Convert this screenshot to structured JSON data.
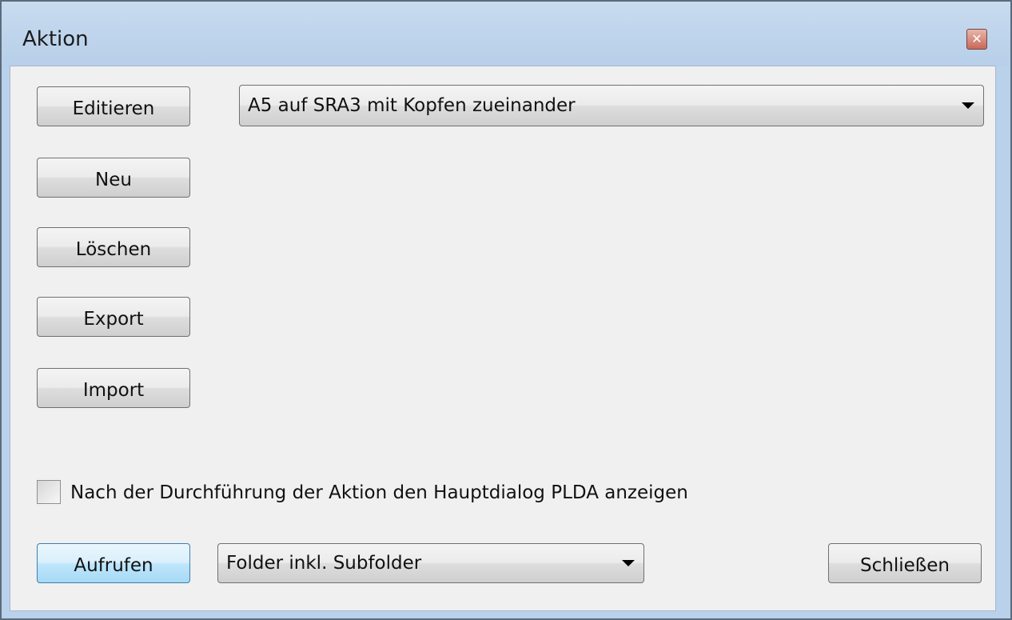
{
  "window": {
    "title": "Aktion",
    "close_glyph": "✕"
  },
  "buttons": {
    "edit": "Editieren",
    "new": "Neu",
    "delete": "Löschen",
    "export": "Export",
    "import": "Import",
    "run": "Aufrufen",
    "close": "Schließen"
  },
  "action_select": {
    "value": "A5 auf SRA3 mit Kopfen zueinander"
  },
  "show_dialog_checkbox": {
    "label": "Nach der Durchführung der Aktion den Hauptdialog PLDA anzeigen",
    "checked": false
  },
  "scope_select": {
    "value": "Folder inkl. Subfolder"
  }
}
